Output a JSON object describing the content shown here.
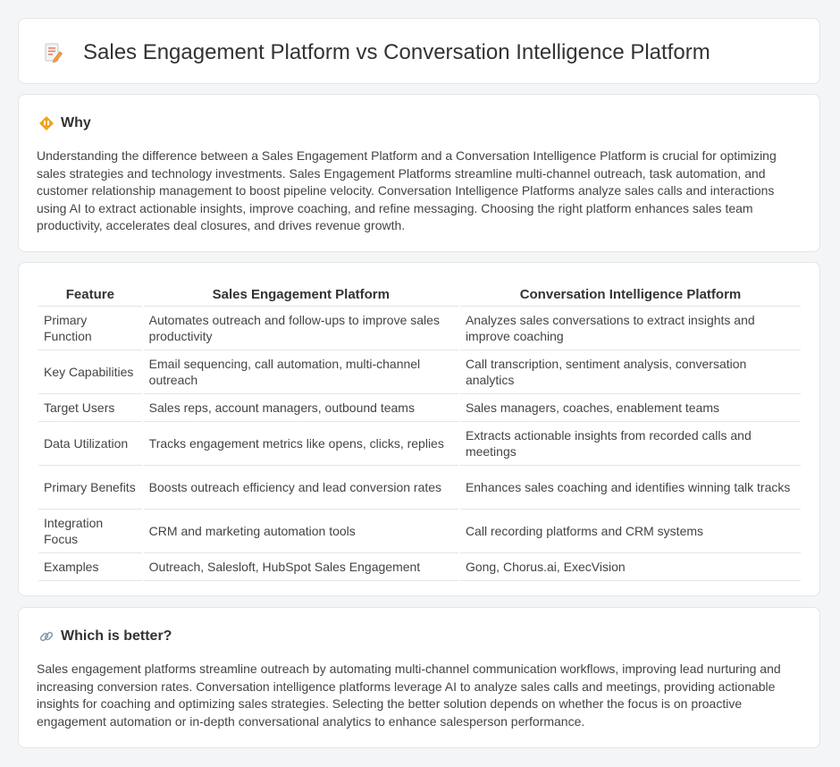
{
  "header": {
    "title": "Sales Engagement Platform vs Conversation Intelligence Platform",
    "icon": "document-edit-icon"
  },
  "why": {
    "title": "Why",
    "icon": "diamond-warning-icon",
    "text": "Understanding the difference between a Sales Engagement Platform and a Conversation Intelligence Platform is crucial for optimizing sales strategies and technology investments. Sales Engagement Platforms streamline multi-channel outreach, task automation, and customer relationship management to boost pipeline velocity. Conversation Intelligence Platforms analyze sales calls and interactions using AI to extract actionable insights, improve coaching, and refine messaging. Choosing the right platform enhances sales team productivity, accelerates deal closures, and drives revenue growth."
  },
  "table": {
    "headers": [
      "Feature",
      "Sales Engagement Platform",
      "Conversation Intelligence Platform"
    ],
    "rows": [
      [
        "Primary Function",
        "Automates outreach and follow-ups to improve sales productivity",
        "Analyzes sales conversations to extract insights and improve coaching"
      ],
      [
        "Key Capabilities",
        "Email sequencing, call automation, multi-channel outreach",
        "Call transcription, sentiment analysis, conversation analytics"
      ],
      [
        "Target Users",
        "Sales reps, account managers, outbound teams",
        "Sales managers, coaches, enablement teams"
      ],
      [
        "Data Utilization",
        "Tracks engagement metrics like opens, clicks, replies",
        "Extracts actionable insights from recorded calls and meetings"
      ],
      [
        "Primary Benefits",
        "Boosts outreach efficiency and lead conversion rates",
        "Enhances sales coaching and identifies winning talk tracks"
      ],
      [
        "Integration Focus",
        "CRM and marketing automation tools",
        "Call recording platforms and CRM systems"
      ],
      [
        "Examples",
        "Outreach, Salesloft, HubSpot Sales Engagement",
        "Gong, Chorus.ai, ExecVision"
      ]
    ]
  },
  "better": {
    "title": "Which is better?",
    "icon": "link-icon",
    "text": "Sales engagement platforms streamline outreach by automating multi-channel communication workflows, improving lead nurturing and increasing conversion rates. Conversation intelligence platforms leverage AI to analyze sales calls and meetings, providing actionable insights for coaching and optimizing sales strategies. Selecting the better solution depends on whether the focus is on proactive engagement automation or in-depth conversational analytics to enhance salesperson performance."
  }
}
